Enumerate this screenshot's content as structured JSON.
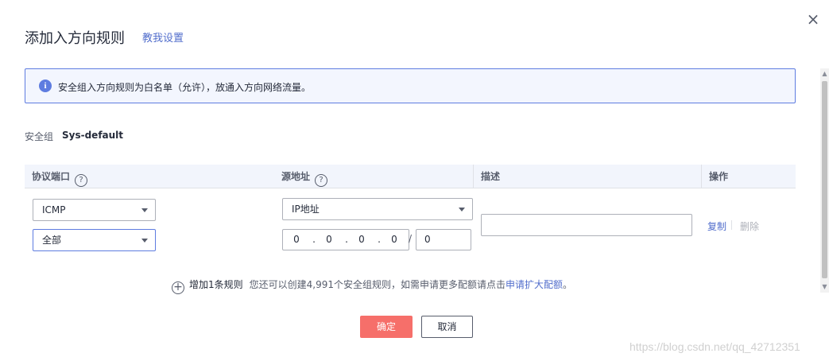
{
  "dialog": {
    "title": "添加入方向规则",
    "help_link": "教我设置",
    "close_symbol": "×"
  },
  "info": {
    "icon_symbol": "i",
    "text": "安全组入方向规则为白名单（允许），放通入方向网络流量。",
    "accent_color": "#5e7ce0"
  },
  "security_group": {
    "label": "安全组",
    "value": "Sys-default"
  },
  "table": {
    "headers": {
      "protocol_port": "协议端口",
      "source": "源地址",
      "description": "描述",
      "actions": "操作"
    },
    "help_symbol": "?"
  },
  "row": {
    "protocol": "ICMP",
    "port": "全部",
    "source_type": "IP地址",
    "ip": [
      "0",
      "0",
      "0",
      "0"
    ],
    "ip_separator": ".",
    "mask_separator": "/",
    "mask": "0",
    "description": "",
    "copy": "复制",
    "delete": "删除"
  },
  "add_rule": {
    "plus_symbol": "+",
    "label": "增加1条规则",
    "quota_text": "您还可以创建4,991个安全组规则，如需申请更多配额请点击",
    "quota_link": "申请扩大配额",
    "quota_suffix": "。"
  },
  "buttons": {
    "ok": "确定",
    "cancel": "取消",
    "ok_color": "#f66f6a"
  },
  "watermark": "https://blog.csdn.net/qq_42712351"
}
